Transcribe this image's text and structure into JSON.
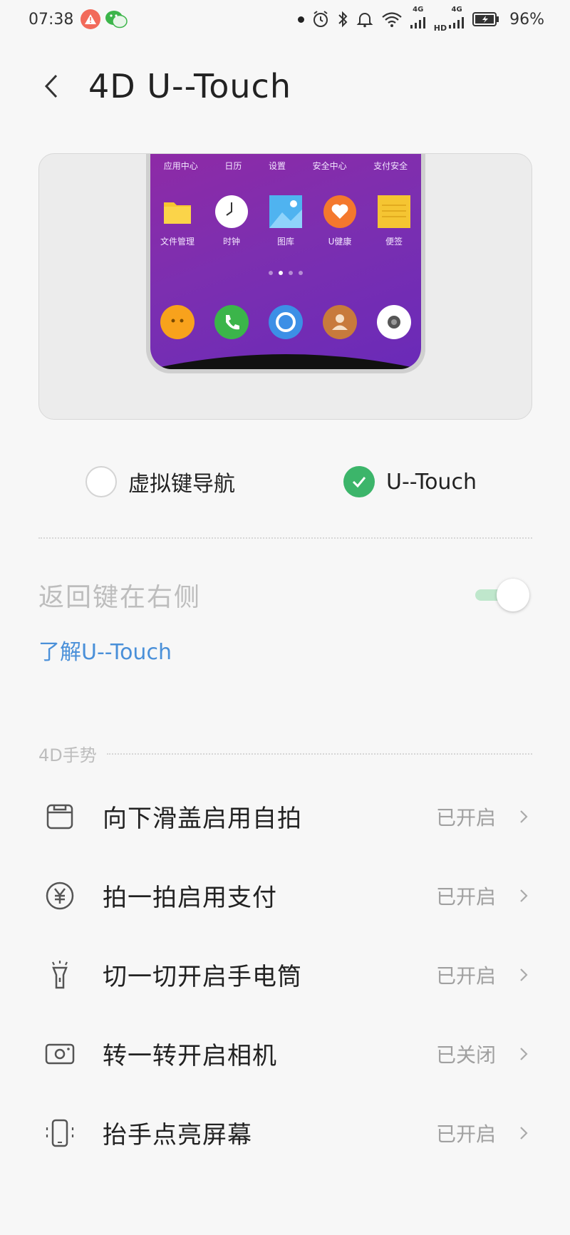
{
  "status_bar": {
    "time": "07:38",
    "network_1": "4G",
    "network_2": "4G",
    "hd_label": "HD",
    "battery": "96%"
  },
  "header": {
    "back_icon": "back-arrow-icon",
    "title": "4D U--Touch"
  },
  "preview": {
    "top_labels": [
      "应用中心",
      "日历",
      "设置",
      "安全中心",
      "支付安全"
    ],
    "apps": [
      {
        "label": "文件管理",
        "icon": "folder-icon",
        "color": "#f7c531"
      },
      {
        "label": "时钟",
        "icon": "clock-icon",
        "color": "#ffffff"
      },
      {
        "label": "图库",
        "icon": "gallery-icon",
        "color": "#4fb3f0"
      },
      {
        "label": "U健康",
        "icon": "health-icon",
        "color": "#f4782d"
      },
      {
        "label": "便签",
        "icon": "notes-icon",
        "color": "#f5c532"
      }
    ],
    "dock": [
      {
        "icon": "message-icon",
        "color": "#f8a21c"
      },
      {
        "icon": "phone-icon",
        "color": "#3bb54a"
      },
      {
        "icon": "browser-icon",
        "color": "#3c8fe6"
      },
      {
        "icon": "contacts-icon",
        "color": "#c87a3c"
      },
      {
        "icon": "camera-icon",
        "color": "#ffffff"
      }
    ]
  },
  "nav_options": {
    "virtual_keys": "虚拟键导航",
    "utouch": "U--Touch",
    "selected": "utouch"
  },
  "back_key_right": {
    "label": "返回键在右侧",
    "enabled": true
  },
  "learn_link": "了解U--Touch",
  "gestures": {
    "section_title": "4D手势",
    "items": [
      {
        "name": "向下滑盖启用自拍",
        "value": "已开启",
        "icon": "slide-cover-icon"
      },
      {
        "name": "拍一拍启用支付",
        "value": "已开启",
        "icon": "yuan-icon"
      },
      {
        "name": "切一切开启手电筒",
        "value": "已开启",
        "icon": "flashlight-icon"
      },
      {
        "name": "转一转开启相机",
        "value": "已关闭",
        "icon": "camera-icon"
      },
      {
        "name": "抬手点亮屏幕",
        "value": "已开启",
        "icon": "phone-wake-icon"
      }
    ]
  },
  "colors": {
    "accent_green": "#3cb56a",
    "link_blue": "#4a90d9"
  }
}
